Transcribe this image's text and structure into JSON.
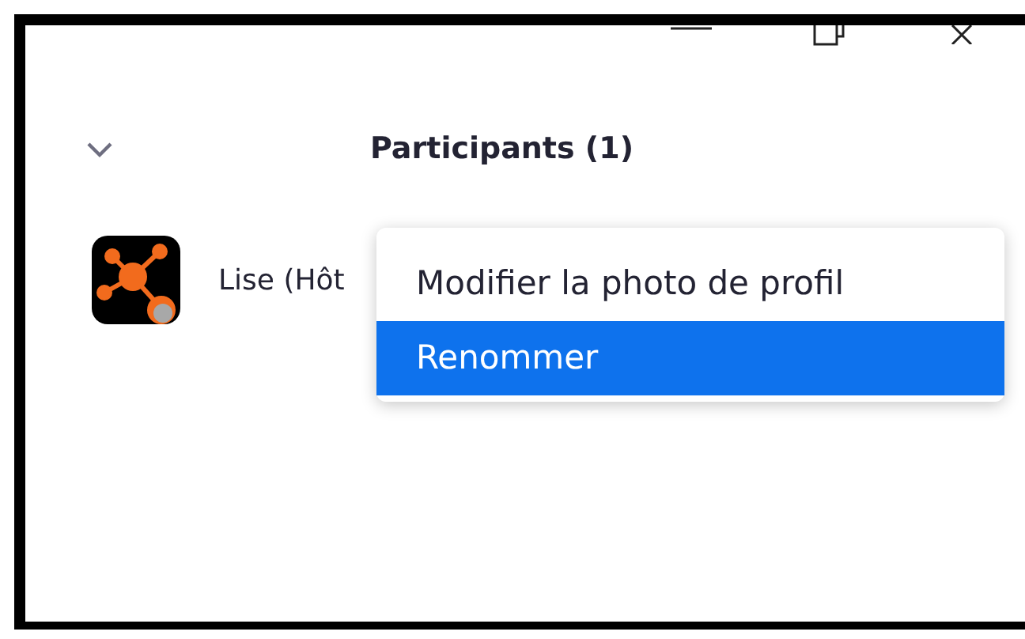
{
  "panel": {
    "title": "Participants (1)",
    "collapsed_chevron": true
  },
  "participants": [
    {
      "name": "Lise (Hôt"
    }
  ],
  "context_menu": {
    "items": [
      {
        "label": "Modifier la photo de profil",
        "selected": false
      },
      {
        "label": "Renommer",
        "selected": true
      }
    ]
  }
}
